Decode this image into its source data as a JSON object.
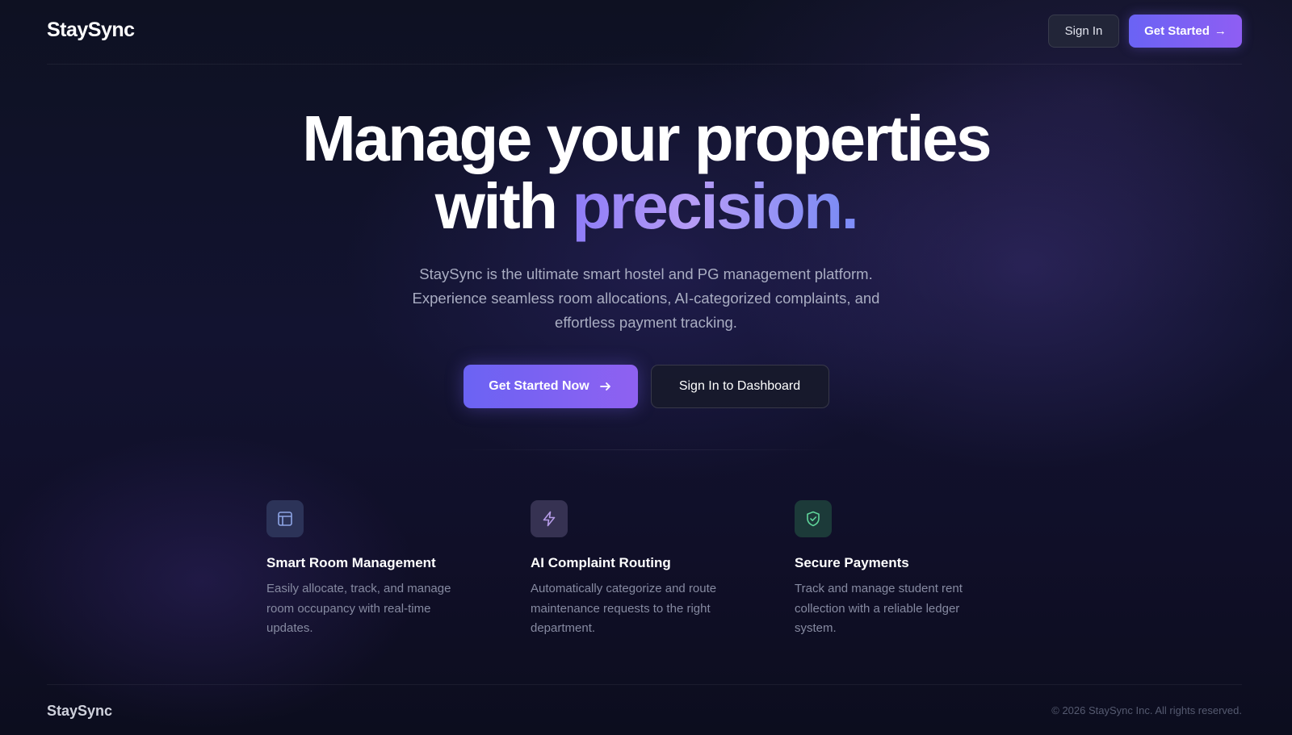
{
  "header": {
    "logo": "StaySync",
    "sign_in_label": "Sign In",
    "get_started_label": "Get Started",
    "get_started_arrow": "→"
  },
  "hero": {
    "title_line1": "Manage your properties",
    "title_line2_prefix": "with",
    "title_accent": "precision",
    "title_dot": ".",
    "subtitle": "StaySync is the ultimate smart hostel and PG management platform. Experience seamless room allocations, AI-categorized complaints, and effortless payment tracking.",
    "cta_primary_label": "Get Started Now",
    "cta_secondary_label": "Sign In to Dashboard"
  },
  "features": [
    {
      "icon": "layout-icon",
      "title": "Smart Room Management",
      "description": "Easily allocate, track, and manage room occupancy with real-time updates."
    },
    {
      "icon": "bolt-icon",
      "title": "AI Complaint Routing",
      "description": "Automatically categorize and route maintenance requests to the right department."
    },
    {
      "icon": "shield-check-icon",
      "title": "Secure Payments",
      "description": "Track and manage student rent collection with a reliable ledger system."
    }
  ],
  "footer": {
    "logo": "StaySync",
    "copyright": "© 2026 StaySync Inc. All rights reserved."
  },
  "colors": {
    "accent_start": "#6a63f4",
    "accent_end": "#8f5ef3",
    "background": "#121330"
  }
}
